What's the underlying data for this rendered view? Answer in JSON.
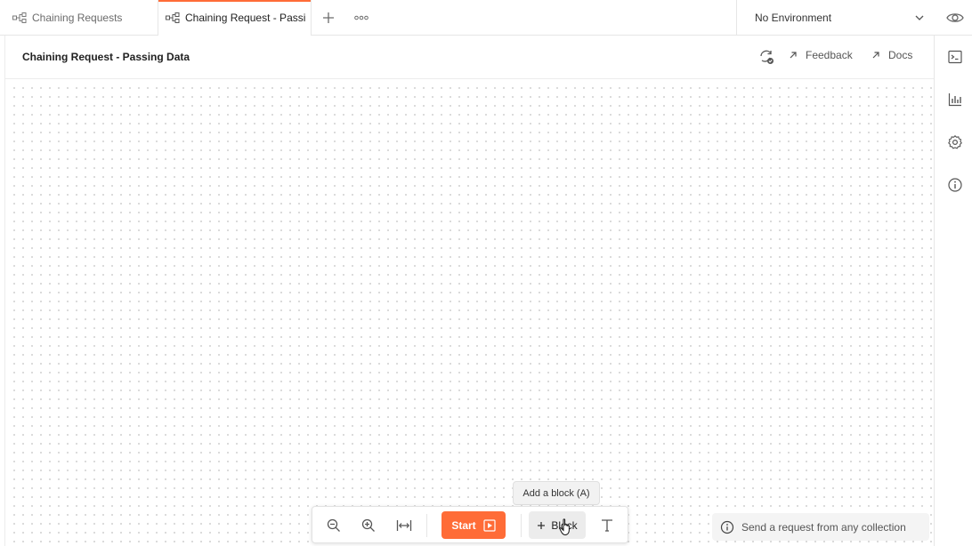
{
  "tabs": [
    {
      "label": "Chaining Requests",
      "icon": "flow-icon",
      "active": false
    },
    {
      "label": "Chaining Request - Passing Data",
      "icon": "flow-icon",
      "active": true
    }
  ],
  "environment": {
    "selected": "No Environment"
  },
  "header": {
    "title": "Chaining Request - Passing Data",
    "feedback_label": "Feedback",
    "docs_label": "Docs"
  },
  "toolbar": {
    "start_label": "Start",
    "block_label": "Block",
    "block_tooltip": "Add a block (A)"
  },
  "info": {
    "text": "Send a request from any collection"
  },
  "colors": {
    "accent": "#ff6c37",
    "border": "#e6e6e6",
    "canvas_dot": "#d2d2d2"
  },
  "right_sidebar": [
    "console-icon",
    "chart-icon",
    "settings-gear-icon",
    "info-icon"
  ]
}
